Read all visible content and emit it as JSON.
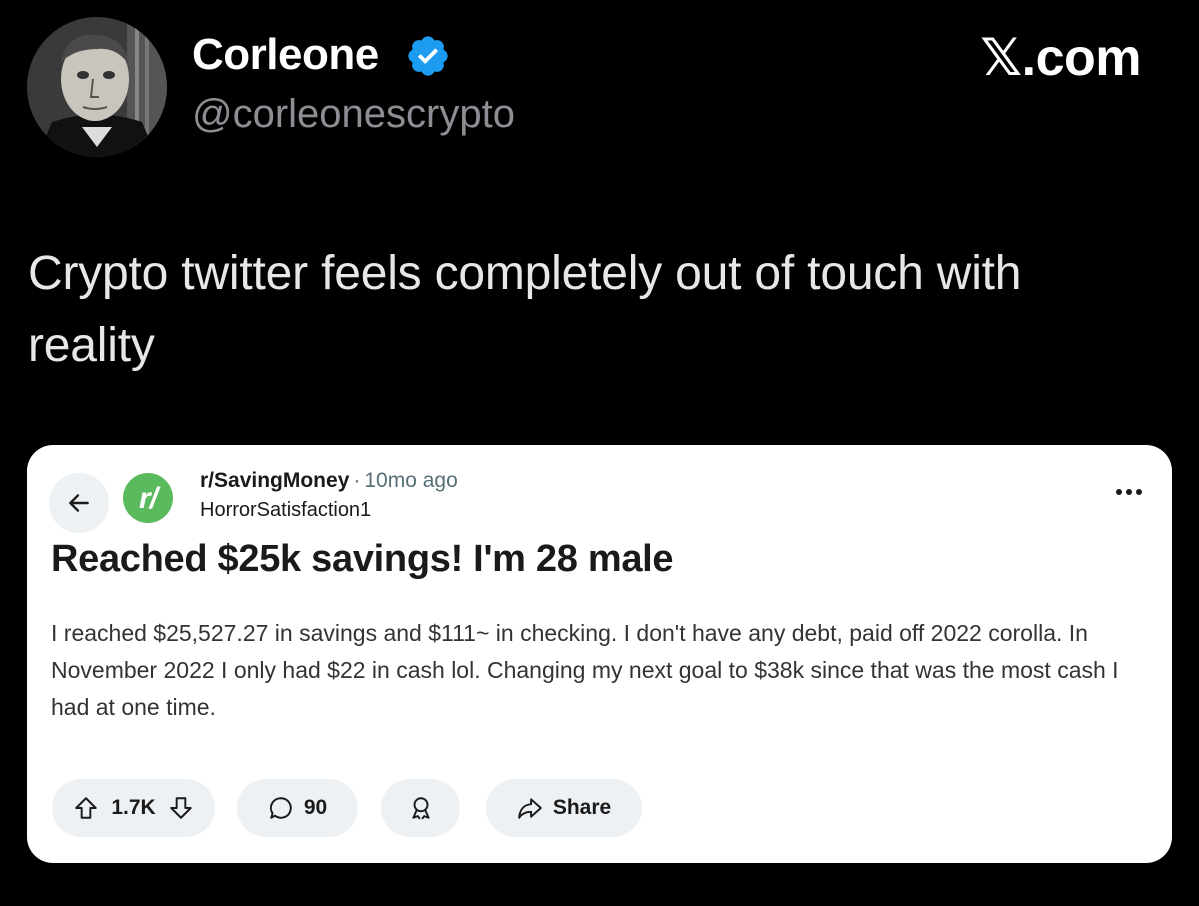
{
  "tweet": {
    "author_name": "Corleone",
    "author_handle": "@corleonescrypto",
    "verified_icon": "verified-badge-icon",
    "verified_color": "#1d9bf0",
    "site_mark": "𝕏.com",
    "text": "Crypto twitter feels completely out of touch with reality"
  },
  "reddit_post": {
    "subreddit": "r/SavingMoney",
    "subreddit_icon_text": "r/",
    "subreddit_icon_color": "#5cba5e",
    "separator": "·",
    "age": "10mo ago",
    "author": "HorrorSatisfaction1",
    "title": "Reached $25k savings! I'm 28 male",
    "body": "I reached $25,527.27 in savings and $111~ in checking. I don't have any debt, paid off 2022 corolla. In November 2022 I only had $22 in cash lol. Changing my next goal to $38k since that was the most cash I had at one time.",
    "votes": "1.7K",
    "comments": "90",
    "share_label": "Share"
  }
}
